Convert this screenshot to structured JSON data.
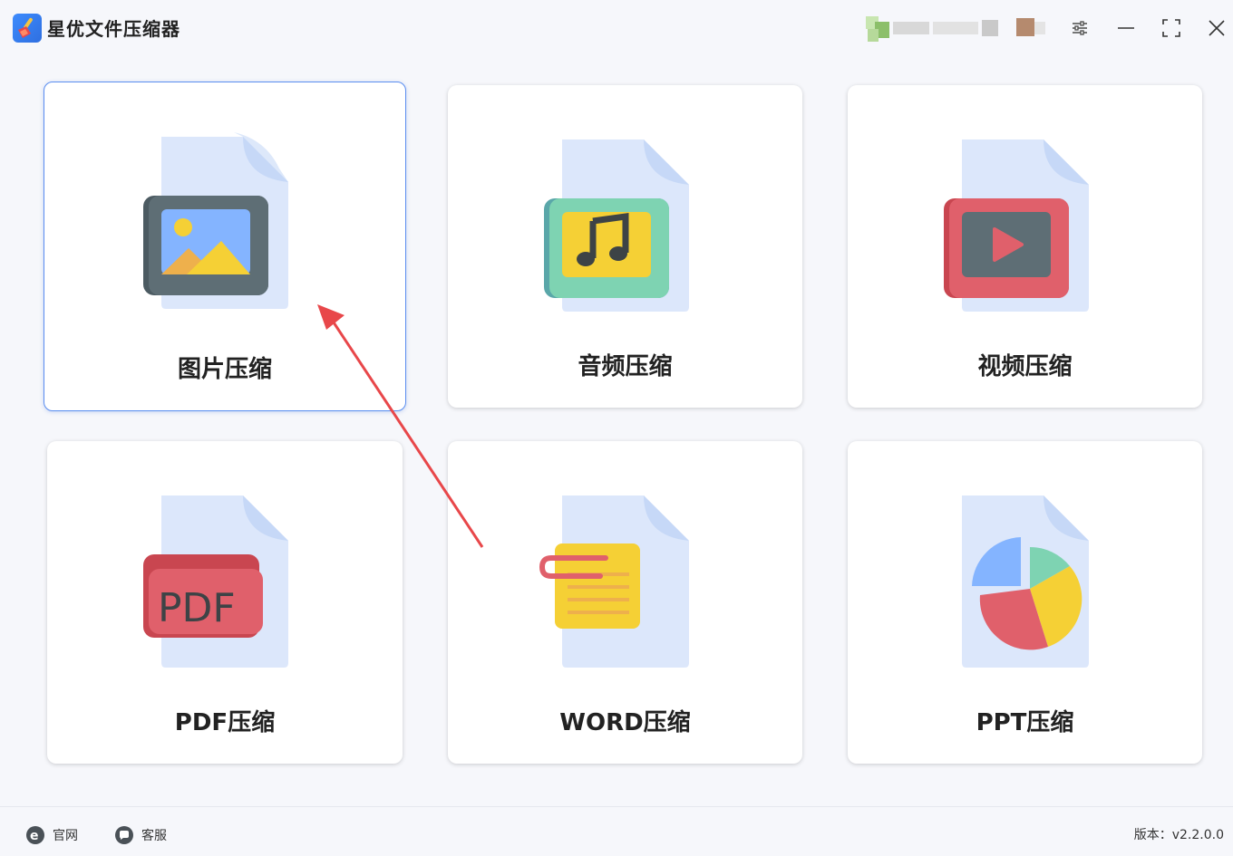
{
  "app": {
    "title": "星优文件压缩器",
    "icons": {
      "logo": "broom-logo-icon",
      "settings": "sliders-icon",
      "minimize": "minimize-icon",
      "maximize": "maximize-icon",
      "close": "close-icon"
    }
  },
  "cards": [
    {
      "id": "image",
      "label": "图片压缩",
      "icon": "image-file-icon",
      "selected": true
    },
    {
      "id": "audio",
      "label": "音频压缩",
      "icon": "audio-file-icon",
      "selected": false
    },
    {
      "id": "video",
      "label": "视频压缩",
      "icon": "video-file-icon",
      "selected": false
    },
    {
      "id": "pdf",
      "label": "PDF压缩",
      "icon": "pdf-file-icon",
      "selected": false
    },
    {
      "id": "word",
      "label": "WORD压缩",
      "icon": "word-file-icon",
      "selected": false
    },
    {
      "id": "ppt",
      "label": "PPT压缩",
      "icon": "ppt-file-icon",
      "selected": false
    }
  ],
  "pdf_icon_text": "PDF",
  "footer": {
    "website_label": "官网",
    "support_label": "客服",
    "version_label": "版本：v2.2.0.0"
  },
  "colors": {
    "accent": "#5b8ef0",
    "arrow": "#e8474a",
    "file_bg": "#dce7fb",
    "file_fold": "#c6d8f7"
  }
}
